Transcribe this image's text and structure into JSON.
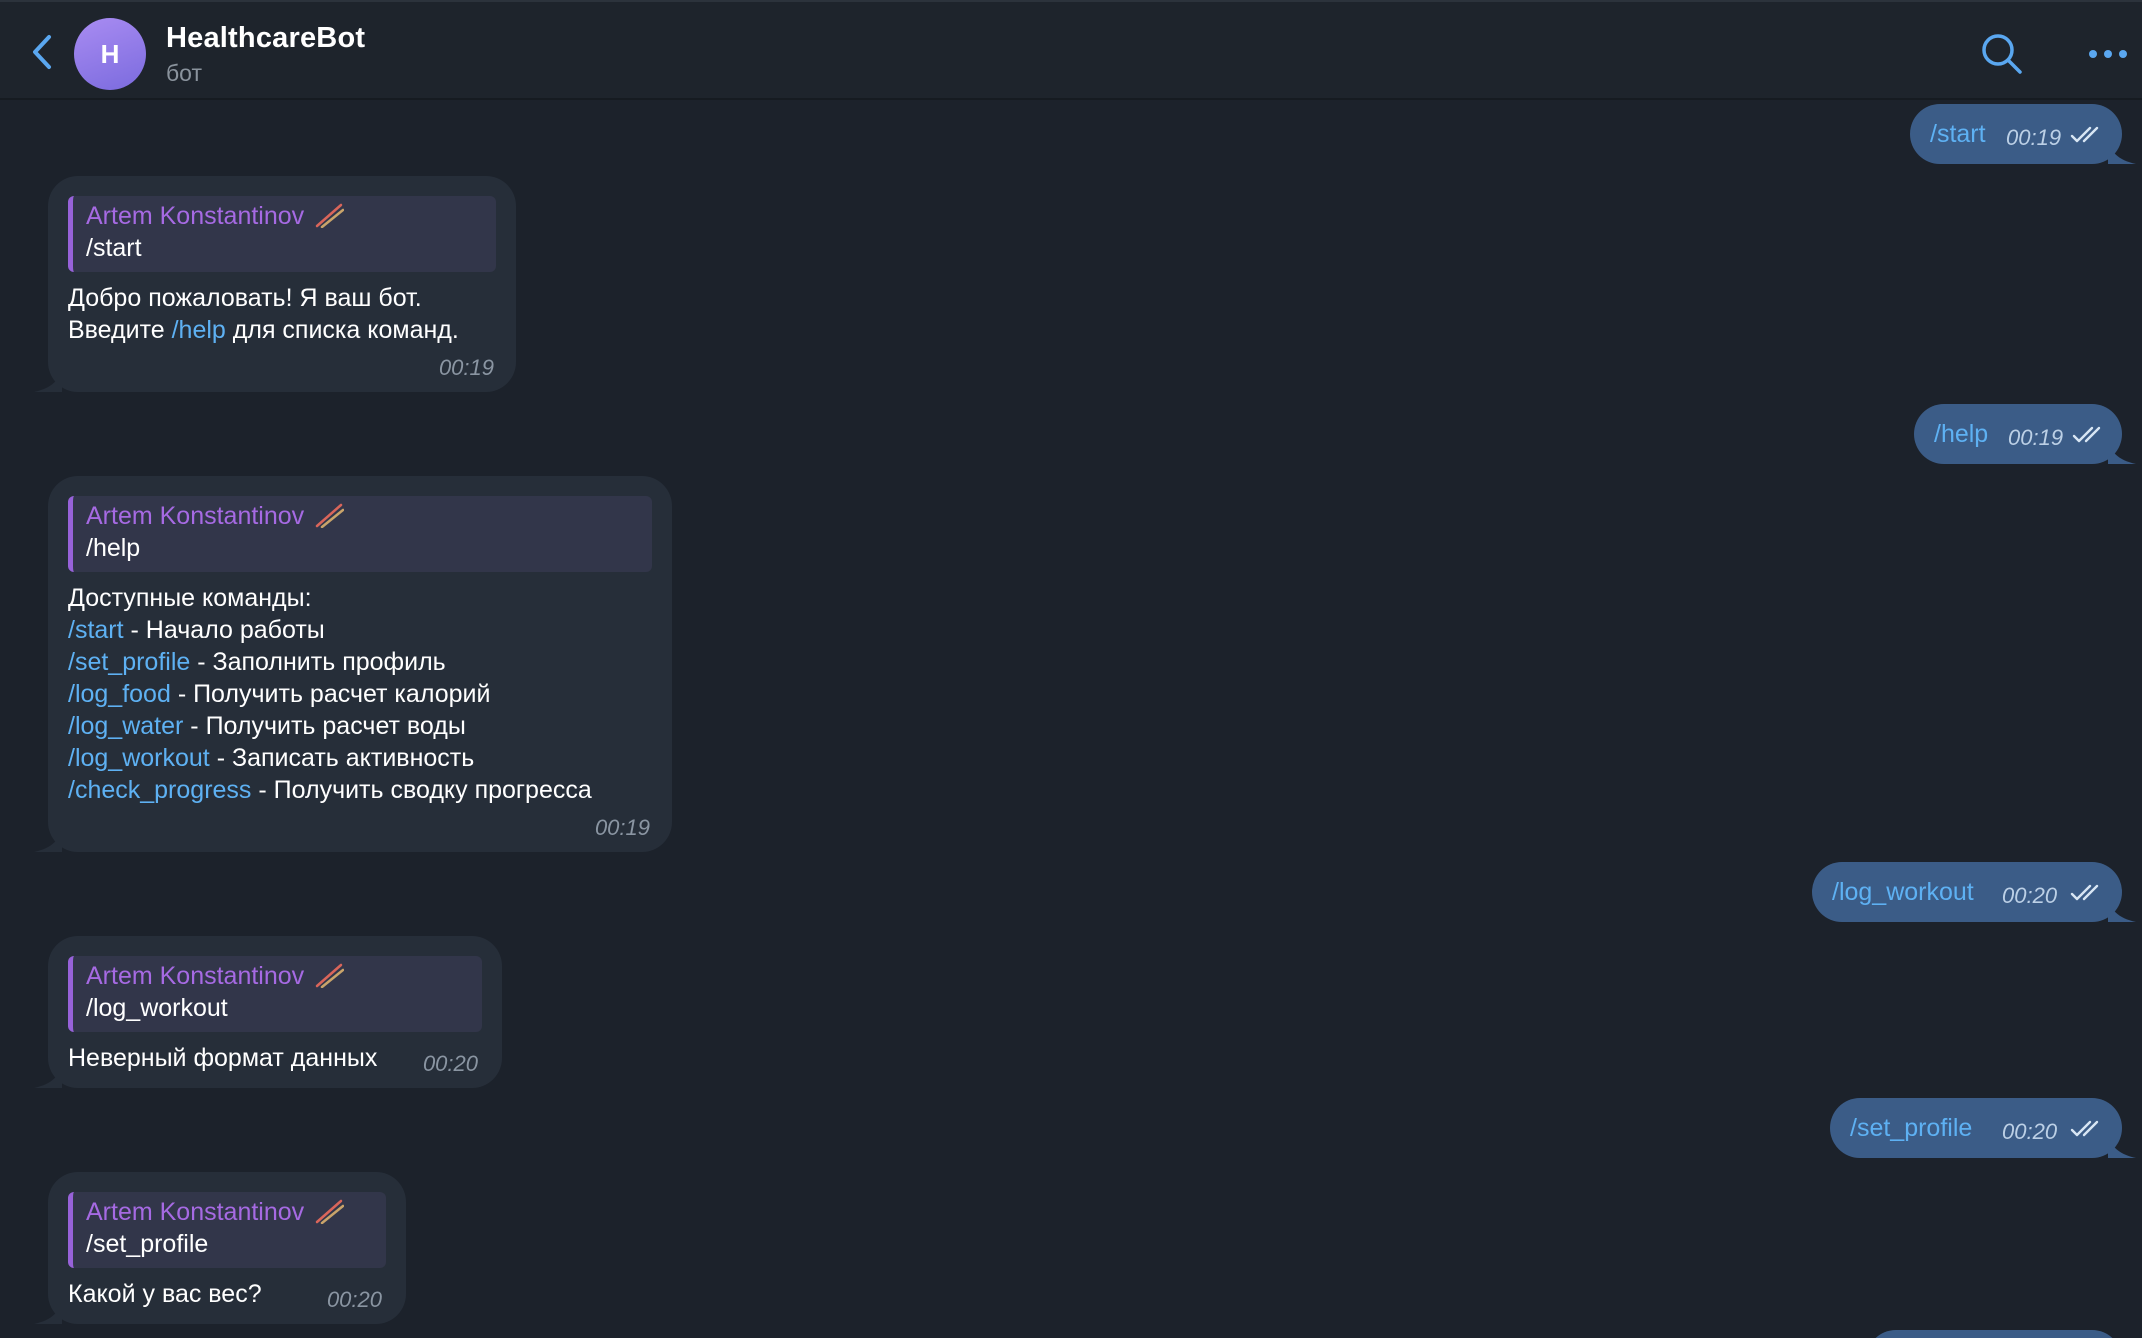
{
  "header": {
    "title": "HealthcareBot",
    "subtitle": "бот",
    "avatar_letter": "H"
  },
  "colors": {
    "background": "#1c222b",
    "incoming_bubble": "#262e39",
    "outgoing_bubble": "#3b5c87",
    "link": "#5eb1f3",
    "reply_name": "#a66ae3",
    "accent": "#5aa7f0"
  },
  "messages": {
    "out1": {
      "text": "/start",
      "time": "00:19",
      "status": "read"
    },
    "in1": {
      "reply_name": "Artem Konstantinov",
      "reply_text": "/start",
      "line1": "Добро пожаловать! Я ваш бот.",
      "line2_pre": "Введите ",
      "line2_cmd": "/help",
      "line2_post": " для списка команд.",
      "time": "00:19"
    },
    "out2": {
      "text": "/help",
      "time": "00:19",
      "status": "read"
    },
    "in2": {
      "reply_name": "Artem Konstantinov",
      "reply_text": "/help",
      "intro": "Доступные команды:",
      "commands": [
        {
          "cmd": "/start",
          "desc": " - Начало работы"
        },
        {
          "cmd": "/set_profile",
          "desc": " - Заполнить профиль"
        },
        {
          "cmd": "/log_food",
          "desc": " - Получить расчет калорий"
        },
        {
          "cmd": "/log_water",
          "desc": " - Получить расчет воды"
        },
        {
          "cmd": "/log_workout",
          "desc": " - Записать активность"
        },
        {
          "cmd": "/check_progress",
          "desc": " - Получить сводку прогресса"
        }
      ],
      "time": "00:19"
    },
    "out3": {
      "text": "/log_workout",
      "time": "00:20",
      "status": "read"
    },
    "in3": {
      "reply_name": "Artem Konstantinov",
      "reply_text": "/log_workout",
      "text": "Неверный формат данных",
      "time": "00:20"
    },
    "out4": {
      "text": "/set_profile",
      "time": "00:20",
      "status": "read"
    },
    "in4": {
      "reply_name": "Artem Konstantinov",
      "reply_text": "/set_profile",
      "text": "Какой у вас вес?",
      "time": "00:20"
    }
  },
  "icons": {
    "back": "chevron-left-icon",
    "search": "search-icon",
    "more": "more-horizontal-icon",
    "read": "double-check-icon",
    "reply_emoji": "chopsticks-icon"
  }
}
